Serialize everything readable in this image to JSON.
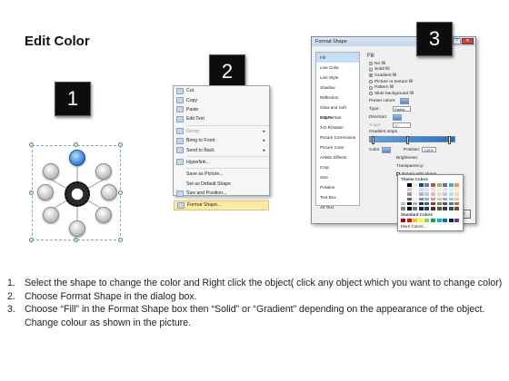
{
  "title": "Edit Color",
  "badges": {
    "one": "1",
    "two": "2",
    "three": "3"
  },
  "context_menu": {
    "items": [
      {
        "label": "Cut",
        "icon": "scissors-icon",
        "disabled": false,
        "submenu": false,
        "highlight": false
      },
      {
        "label": "Copy",
        "icon": "copy-icon",
        "disabled": false,
        "submenu": false,
        "highlight": false
      },
      {
        "label": "Paste",
        "icon": "paste-icon",
        "disabled": false,
        "submenu": false,
        "highlight": false
      },
      {
        "label": "Edit Text",
        "icon": "edit-text-icon",
        "disabled": false,
        "submenu": false,
        "highlight": false
      },
      {
        "label": "Group",
        "icon": "group-icon",
        "disabled": true,
        "submenu": true,
        "highlight": false
      },
      {
        "label": "Bring to Front",
        "icon": "bring-front-icon",
        "disabled": false,
        "submenu": true,
        "highlight": false
      },
      {
        "label": "Send to Back",
        "icon": "send-back-icon",
        "disabled": false,
        "submenu": true,
        "highlight": false
      },
      {
        "label": "Hyperlink...",
        "icon": "hyperlink-icon",
        "disabled": false,
        "submenu": false,
        "highlight": false
      },
      {
        "label": "Save as Picture...",
        "icon": "",
        "disabled": false,
        "submenu": false,
        "highlight": false
      },
      {
        "label": "Set as Default Shape",
        "icon": "",
        "disabled": false,
        "submenu": false,
        "highlight": false
      },
      {
        "label": "Size and Position...",
        "icon": "size-icon",
        "disabled": false,
        "submenu": false,
        "highlight": false
      },
      {
        "label": "Format Shape...",
        "icon": "format-shape-icon",
        "disabled": false,
        "submenu": false,
        "highlight": true
      }
    ]
  },
  "dialog": {
    "title": "Format Shape",
    "close_label": "Close",
    "nav": [
      "Fill",
      "Line Color",
      "Line Style",
      "Shadow",
      "Reflection",
      "Glow and Soft Edges",
      "3-D Format",
      "3-D Rotation",
      "Picture Corrections",
      "Picture Color",
      "Artistic Effects",
      "Crop",
      "Size",
      "Position",
      "Text Box",
      "Alt Text"
    ],
    "pane_heading": "Fill",
    "fill_options": [
      {
        "label": "No fill",
        "selected": false
      },
      {
        "label": "Solid fill",
        "selected": false
      },
      {
        "label": "Gradient fill",
        "selected": true
      },
      {
        "label": "Picture or texture fill",
        "selected": false
      },
      {
        "label": "Pattern fill",
        "selected": false
      },
      {
        "label": "Slide background fill",
        "selected": false
      }
    ],
    "preset_label": "Preset colors:",
    "type_label": "Type:",
    "type_value": "Radial",
    "direction_label": "Direction:",
    "angle_label": "Angle:",
    "angle_value": "90°",
    "stops_label": "Gradient stops",
    "color_label": "Color",
    "position_label": "Position:",
    "position_value": "100%",
    "brightness_label": "Brightness:",
    "transparency_label": "Transparency:",
    "rotate_label": "Rotate with shape"
  },
  "palette": {
    "theme_heading": "Theme Colors",
    "standard_heading": "Standard Colors",
    "more_label": "More Colors...",
    "theme_colors": [
      "#ffffff",
      "#000000",
      "#eeece1",
      "#1f497d",
      "#4f81bd",
      "#c0504d",
      "#9bbb59",
      "#8064a2",
      "#4bacc6",
      "#f79646"
    ],
    "standard_colors": [
      "#c00000",
      "#ff0000",
      "#ffc000",
      "#ffff00",
      "#92d050",
      "#00b050",
      "#00b0f0",
      "#0070c0",
      "#002060",
      "#7030a0"
    ]
  },
  "instructions": [
    {
      "num": "1.",
      "text": "Select the shape to change the color and Right click the object( click any object which you want to change color)"
    },
    {
      "num": "2.",
      "text": "Choose Format Shape in the dialog box."
    },
    {
      "num": "3.",
      "text": "Choose “Fill” in the Format Shape box then “Solid” or “Gradient” depending on the appearance of the object. Change colour as shown in the picture."
    }
  ]
}
